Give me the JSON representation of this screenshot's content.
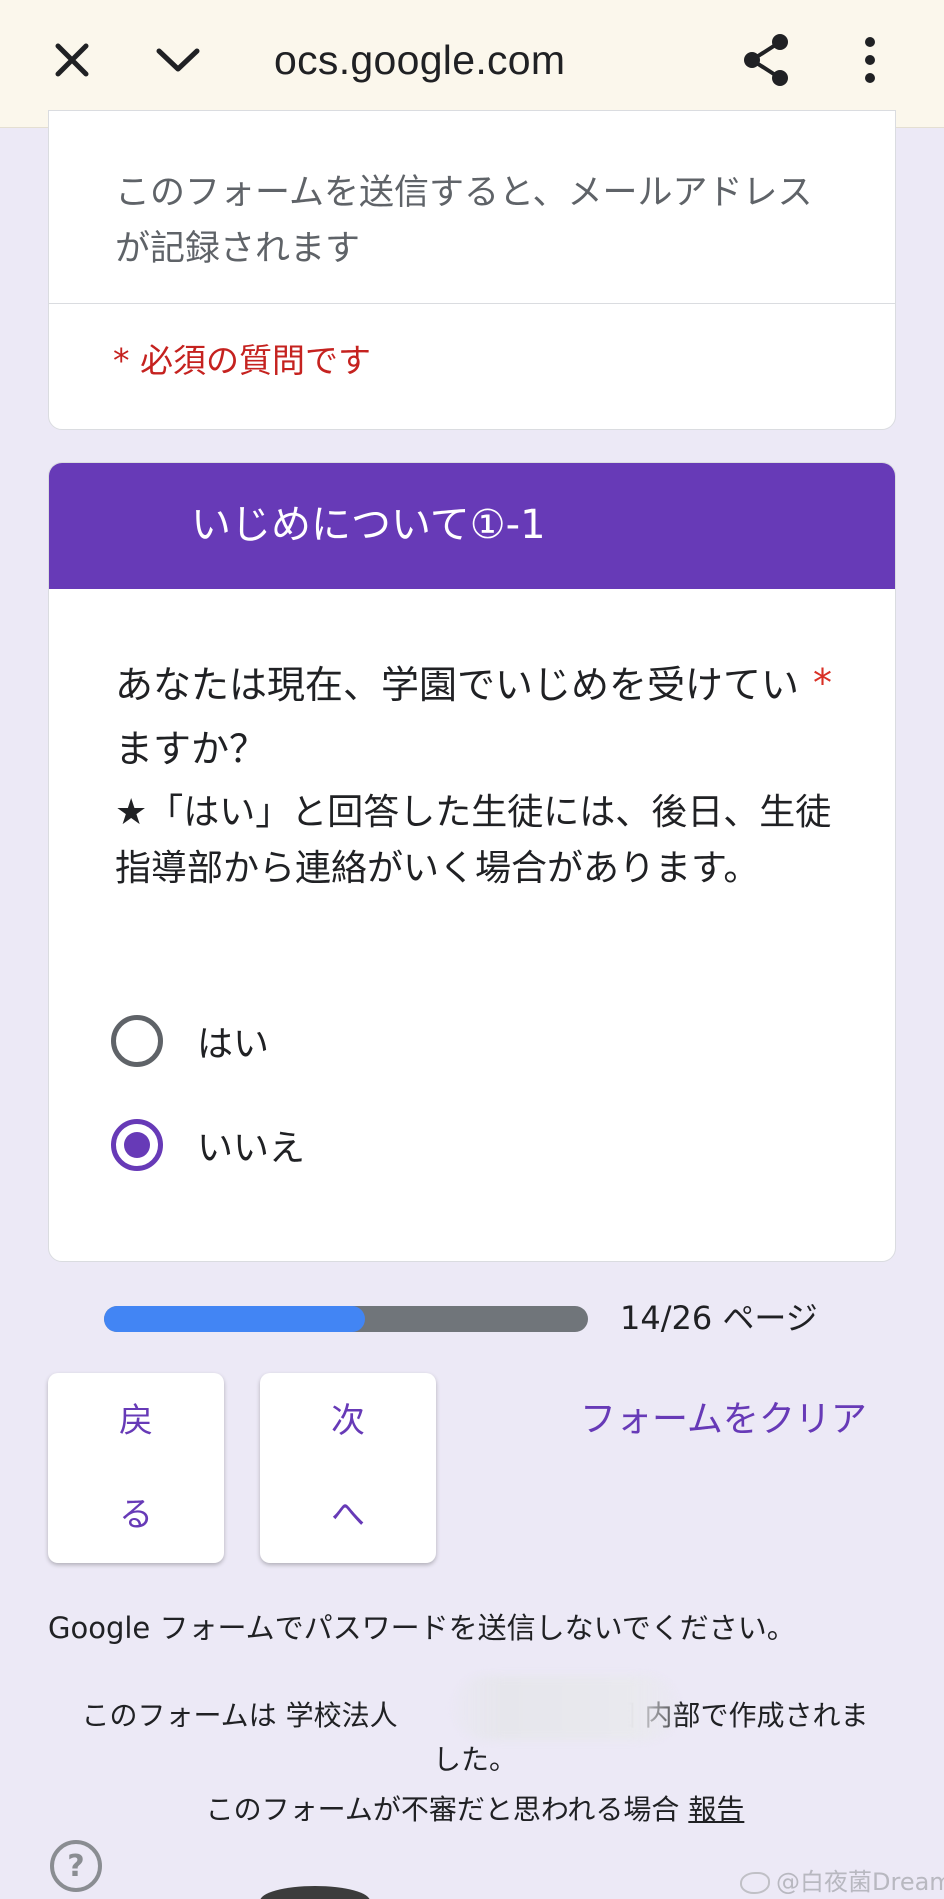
{
  "browser": {
    "url": "ocs.google.com",
    "close_icon": "close-icon",
    "chevron_icon": "chevron-down-icon",
    "share_icon": "share-icon",
    "menu_icon": "more-vert-icon"
  },
  "form": {
    "email_note": "このフォームを送信すると、メールアドレスが記録されます",
    "required_note": "* 必須の質問です",
    "section_title": "いじめについて①-1",
    "question": {
      "text": "あなたは現在、学園でいじめを受けていますか？",
      "required_mark": "*",
      "description": "★「はい」と回答した生徒には、後日、生徒指導部から連絡がいく場合があります。",
      "options": [
        {
          "label": "はい",
          "selected": false
        },
        {
          "label": "いいえ",
          "selected": true
        }
      ]
    }
  },
  "progress": {
    "current": 14,
    "total": 26,
    "label": "14/26 ページ"
  },
  "nav": {
    "back_chars": [
      "戻",
      "る"
    ],
    "next_chars": [
      "次",
      "へ"
    ],
    "clear_label": "フォームをクリア"
  },
  "footer": {
    "password_warning": "Google フォームでパスワードを送信しないでください。",
    "owner_note_a": "このフォームは 学校法人",
    "owner_note_b": "園 内部で作成されました。",
    "report_prefix": "このフォームが不審だと思われる場合",
    "report_link": "報告",
    "help_glyph": "?",
    "watermark": "@白夜菌Dream"
  },
  "colors": {
    "accent": "#673ab7",
    "required": "#c5221f",
    "progress_fill": "#4285f4",
    "progress_track": "#70757a",
    "page_bg": "#ece9f6"
  }
}
